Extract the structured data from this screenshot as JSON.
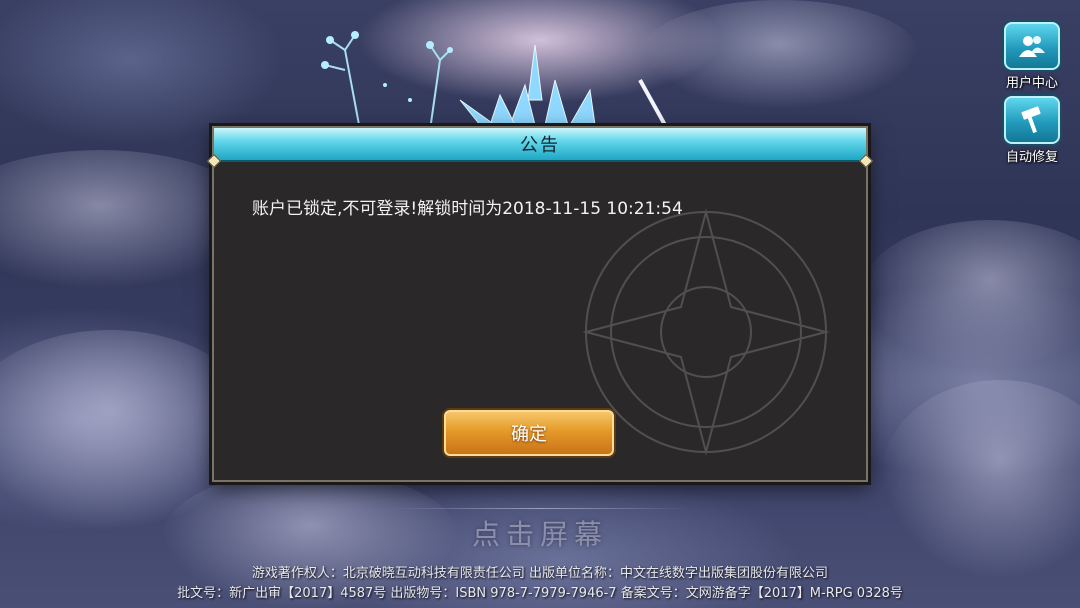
{
  "side_buttons": {
    "user_center": {
      "label": "用户中心",
      "icon": "users-icon"
    },
    "auto_repair": {
      "label": "自动修复",
      "icon": "hammer-icon"
    }
  },
  "dialog": {
    "title": "公告",
    "message": "账户已锁定,不可登录!解锁时间为2018-11-15 10:21:54",
    "confirm_label": "确定"
  },
  "tap_screen": "点击屏幕",
  "footer": {
    "line1": "游戏著作权人：北京破晓互动科技有限责任公司  出版单位名称：中文在线数字出版集团股份有限公司",
    "line2": "批文号：新广出审【2017】4587号  出版物号：ISBN 978-7-7979-7946-7  备案文号：文网游备字【2017】M-RPG 0328号"
  },
  "colors": {
    "header_accent": "#62d7ea",
    "button_gold": "#e59a28",
    "dialog_bg": "#2a2828"
  }
}
